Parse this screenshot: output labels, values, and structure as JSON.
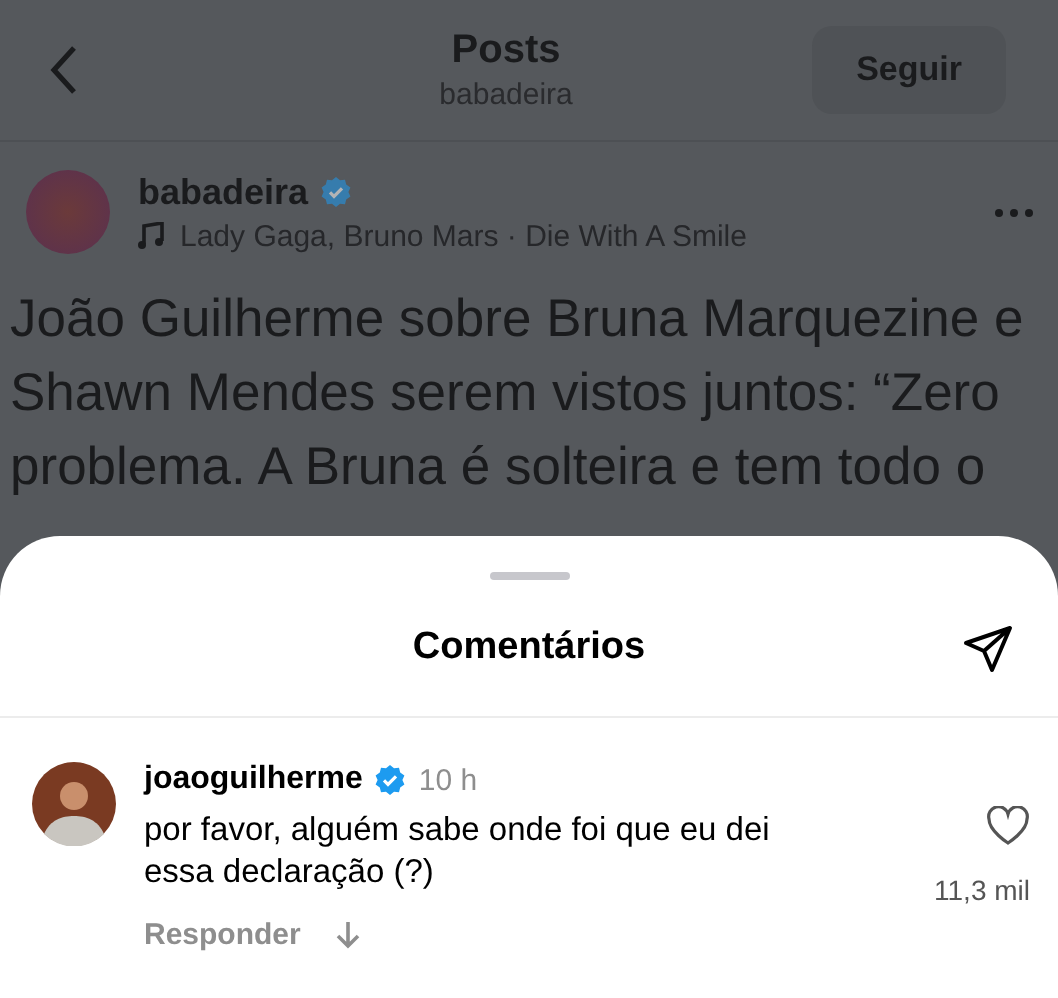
{
  "header": {
    "title": "Posts",
    "subtitle": "babadeira",
    "follow_button": "Seguir"
  },
  "post": {
    "username": "babadeira",
    "verified": true,
    "music": "Lady Gaga, Bruno Mars · Die With A Smile",
    "text_lines": [
      "João Guilherme sobre Bruna Marquezine e",
      "Shawn Mendes serem vistos juntos: “Zero",
      "problema. A Bruna é solteira e tem todo o"
    ]
  },
  "comments_sheet": {
    "title": "Comentários",
    "comments": [
      {
        "username": "joaoguilherme",
        "verified": true,
        "time": "10 h",
        "text": "por favor, alguém sabe onde foi que eu dei essa declaração (?)",
        "likes": "11,3 mil",
        "liked": false,
        "reply": "Responder"
      }
    ]
  }
}
